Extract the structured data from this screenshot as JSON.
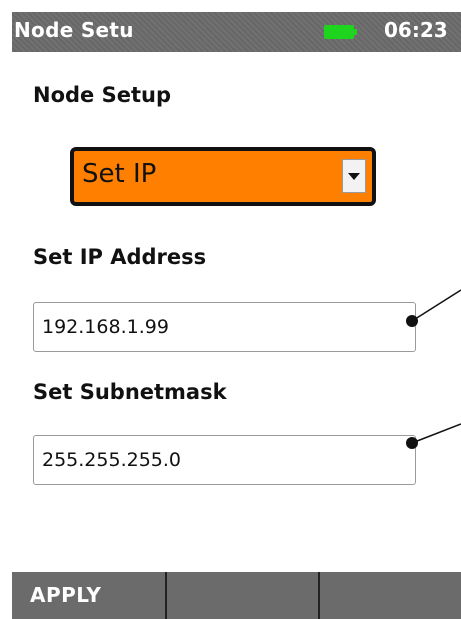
{
  "status_bar": {
    "title": "Node Setu",
    "time": "06:23",
    "battery_icon": "battery-full-icon",
    "battery_color": "#1ed41e",
    "background_color": "#6b6b6b"
  },
  "main": {
    "section_title": "Node Setup",
    "mode_select": {
      "selected_value": "Set IP",
      "background_color": "#ff8000"
    },
    "ip_address": {
      "label": "Set IP Address",
      "value": "192.168.1.99"
    },
    "subnet_mask": {
      "label": "Set Subnetmask",
      "value": "255.255.255.0"
    }
  },
  "softkeys": [
    {
      "label": "APPLY"
    },
    {
      "label": ""
    },
    {
      "label": ""
    }
  ]
}
